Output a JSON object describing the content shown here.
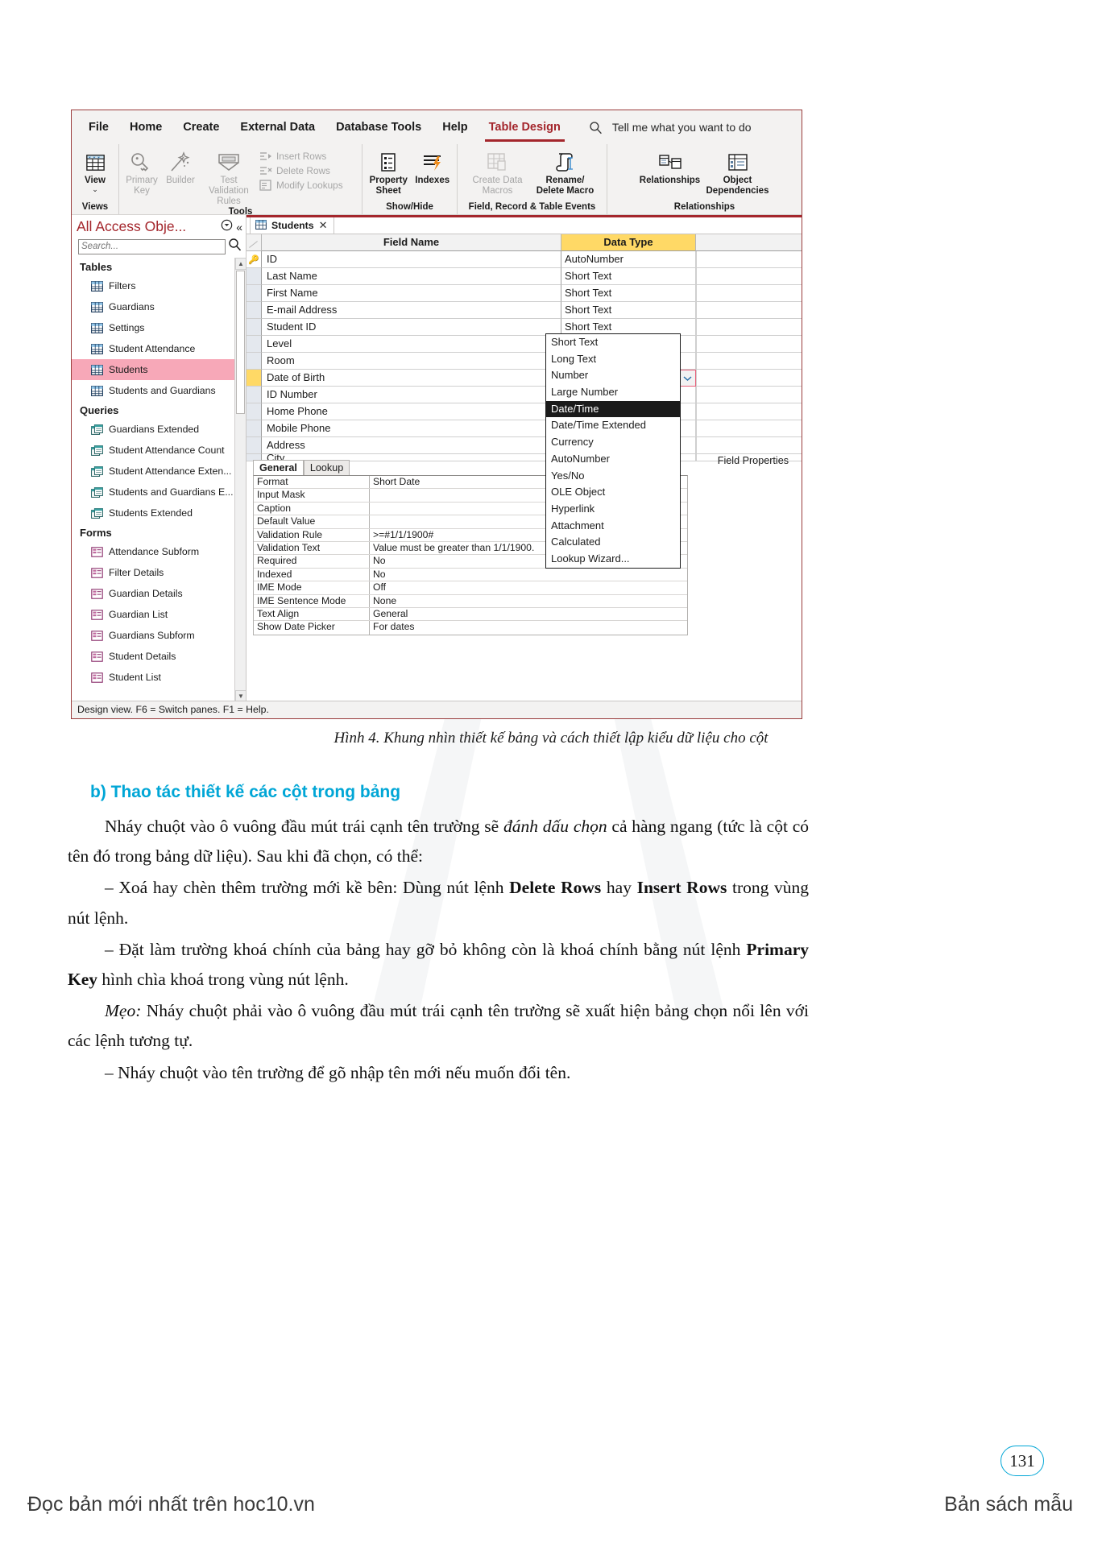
{
  "app": {
    "ribbon_tabs": [
      {
        "label": "File",
        "active": false
      },
      {
        "label": "Home",
        "active": false
      },
      {
        "label": "Create",
        "active": false
      },
      {
        "label": "External Data",
        "active": false
      },
      {
        "label": "Database Tools",
        "active": false
      },
      {
        "label": "Help",
        "active": false
      },
      {
        "label": "Table Design",
        "active": true
      }
    ],
    "tell_me": "Tell me what you want to do",
    "search_icon": "search-icon",
    "accent_color": "#a4262c",
    "groups": [
      {
        "label": "Views",
        "big_buttons": [
          {
            "label": "View",
            "icon": "table-view-icon",
            "has_dropdown": true,
            "disabled": false
          }
        ],
        "small_buttons": []
      },
      {
        "label": "Tools",
        "big_buttons": [
          {
            "label": "Primary\nKey",
            "icon": "key-icon",
            "disabled": true
          },
          {
            "label": "Builder",
            "icon": "magic-wand-icon",
            "disabled": true
          },
          {
            "label": "Test Validation\nRules",
            "icon": "validation-rules-icon",
            "disabled": true
          }
        ],
        "small_buttons": [
          {
            "label": "Insert Rows",
            "icon": "insert-rows-icon",
            "disabled": true
          },
          {
            "label": "Delete Rows",
            "icon": "delete-rows-icon",
            "disabled": true
          },
          {
            "label": "Modify Lookups",
            "icon": "modify-lookups-icon",
            "disabled": true
          }
        ]
      },
      {
        "label": "Show/Hide",
        "big_buttons": [
          {
            "label": "Property\nSheet",
            "icon": "property-sheet-icon",
            "disabled": false
          },
          {
            "label": "Indexes",
            "icon": "indexes-icon",
            "disabled": false
          }
        ],
        "small_buttons": []
      },
      {
        "label": "Field, Record & Table Events",
        "big_buttons": [
          {
            "label": "Create Data\nMacros",
            "icon": "create-data-macros-icon",
            "has_dropdown": true,
            "disabled": true
          },
          {
            "label": "Rename/\nDelete Macro",
            "icon": "rename-delete-macro-icon",
            "disabled": false
          }
        ],
        "small_buttons": []
      },
      {
        "label": "Relationships",
        "big_buttons": [
          {
            "label": "Relationships",
            "icon": "relationships-icon",
            "disabled": false
          },
          {
            "label": "Object\nDependencies",
            "icon": "object-dependencies-icon",
            "disabled": false
          }
        ],
        "small_buttons": []
      }
    ]
  },
  "nav_pane": {
    "title": "All Access Obje...",
    "dropdown_icon": "chevron-circle-down-icon",
    "collapse_icon": "double-chevron-left-icon",
    "search_placeholder": "Search...",
    "search_value": "",
    "search_icon": "magnifier-icon",
    "sections": [
      {
        "label": "Tables",
        "collapse_icon": "double-chevron-up-icon",
        "items": [
          {
            "label": "Filters",
            "icon": "table-icon",
            "selected": false
          },
          {
            "label": "Guardians",
            "icon": "table-icon",
            "selected": false
          },
          {
            "label": "Settings",
            "icon": "table-icon",
            "selected": false
          },
          {
            "label": "Student Attendance",
            "icon": "table-icon",
            "selected": false
          },
          {
            "label": "Students",
            "icon": "table-icon",
            "selected": true
          },
          {
            "label": "Students and Guardians",
            "icon": "table-icon",
            "selected": false
          }
        ]
      },
      {
        "label": "Queries",
        "collapse_icon": "double-chevron-up-icon",
        "items": [
          {
            "label": "Guardians Extended",
            "icon": "query-icon",
            "selected": false
          },
          {
            "label": "Student Attendance Count",
            "icon": "query-icon",
            "selected": false
          },
          {
            "label": "Student Attendance Exten...",
            "icon": "query-icon",
            "selected": false
          },
          {
            "label": "Students and Guardians E...",
            "icon": "query-icon",
            "selected": false
          },
          {
            "label": "Students Extended",
            "icon": "query-icon",
            "selected": false
          }
        ]
      },
      {
        "label": "Forms",
        "collapse_icon": "double-chevron-up-icon",
        "items": [
          {
            "label": "Attendance Subform",
            "icon": "form-icon",
            "selected": false
          },
          {
            "label": "Filter Details",
            "icon": "form-icon",
            "selected": false
          },
          {
            "label": "Guardian Details",
            "icon": "form-icon",
            "selected": false
          },
          {
            "label": "Guardian List",
            "icon": "form-icon",
            "selected": false
          },
          {
            "label": "Guardians Subform",
            "icon": "form-icon",
            "selected": false
          },
          {
            "label": "Student Details",
            "icon": "form-icon",
            "selected": false
          },
          {
            "label": "Student List",
            "icon": "form-icon",
            "selected": false
          }
        ]
      }
    ]
  },
  "document_tab": {
    "label": "Students",
    "icon": "table-icon",
    "close_icon": "close-icon"
  },
  "design_grid": {
    "headers": {
      "field_name": "Field Name",
      "data_type": "Data Type"
    },
    "rows": [
      {
        "field": "ID",
        "type": "AutoNumber",
        "marker": "key",
        "active": false
      },
      {
        "field": "Last Name",
        "type": "Short Text",
        "marker": "",
        "active": false
      },
      {
        "field": "First Name",
        "type": "Short Text",
        "marker": "",
        "active": false
      },
      {
        "field": "E-mail Address",
        "type": "Short Text",
        "marker": "",
        "active": false
      },
      {
        "field": "Student ID",
        "type": "Short Text",
        "marker": "",
        "active": false
      },
      {
        "field": "Level",
        "type": "Short Text",
        "marker": "",
        "active": false
      },
      {
        "field": "Room",
        "type": "Short Text",
        "marker": "",
        "active": false
      },
      {
        "field": "Date of Birth",
        "type": "Date/Time",
        "marker": "current",
        "active": true
      },
      {
        "field": "ID Number",
        "type": "",
        "marker": "",
        "active": false
      },
      {
        "field": "Home Phone",
        "type": "",
        "marker": "",
        "active": false
      },
      {
        "field": "Mobile Phone",
        "type": "",
        "marker": "",
        "active": false
      },
      {
        "field": "Address",
        "type": "",
        "marker": "",
        "active": false
      },
      {
        "field": "City",
        "type": "",
        "marker": "",
        "active": false
      }
    ]
  },
  "data_type_dropdown": {
    "open": true,
    "selected": "Date/Time",
    "options": [
      "Short Text",
      "Long Text",
      "Number",
      "Large Number",
      "Date/Time",
      "Date/Time Extended",
      "Currency",
      "AutoNumber",
      "Yes/No",
      "OLE Object",
      "Hyperlink",
      "Attachment",
      "Calculated",
      "Lookup Wizard..."
    ]
  },
  "field_properties": {
    "panel_label": "Field Properties",
    "tabs": [
      {
        "label": "General",
        "active": true
      },
      {
        "label": "Lookup",
        "active": false
      }
    ],
    "rows": [
      {
        "name": "Format",
        "value": "Short Date"
      },
      {
        "name": "Input Mask",
        "value": ""
      },
      {
        "name": "Caption",
        "value": ""
      },
      {
        "name": "Default Value",
        "value": ""
      },
      {
        "name": "Validation Rule",
        "value": ">=#1/1/1900#"
      },
      {
        "name": "Validation Text",
        "value": "Value must be greater than 1/1/1900."
      },
      {
        "name": "Required",
        "value": "No"
      },
      {
        "name": "Indexed",
        "value": "No"
      },
      {
        "name": "IME Mode",
        "value": "Off"
      },
      {
        "name": "IME Sentence Mode",
        "value": "None"
      },
      {
        "name": "Text Align",
        "value": "General"
      },
      {
        "name": "Show Date Picker",
        "value": "For dates"
      }
    ]
  },
  "status_bar": {
    "text": "Design view.  F6 = Switch panes.  F1 = Help."
  },
  "page": {
    "figure_caption": "Hình 4. Khung nhìn thiết kế bảng và cách thiết lập kiểu dữ liệu cho cột",
    "sub_heading": "b) Thao tác thiết kế các cột trong bảng",
    "paragraphs": [
      "Nháy chuột vào ô vuông đầu mút trái cạnh tên trường sẽ <i>đánh dấu chọn</i> cả hàng ngang (tức là cột có tên đó trong bảng dữ liệu). Sau khi đã chọn, có thể:",
      "– Xoá hay chèn thêm trường mới kề bên: Dùng nút lệnh <b>Delete Rows</b> hay <b>Insert Rows</b> trong vùng nút lệnh.",
      "– Đặt làm trường khoá chính của bảng hay gỡ bỏ không còn là khoá chính bằng nút lệnh <b>Primary Key</b> hình chìa khoá trong vùng nút lệnh.",
      "<i>Mẹo:</i> Nháy chuột phải vào ô vuông đầu mút trái cạnh tên trường sẽ xuất hiện bảng chọn nổi lên với các lệnh tương tự.",
      "– Nháy chuột vào tên trường để gõ nhập tên mới nếu muốn đổi tên."
    ],
    "footer_left": "Đọc bản mới nhất trên hoc10.vn",
    "footer_right": "Bản sách mẫu",
    "page_number": "131",
    "heading_color": "#00a6d6"
  }
}
